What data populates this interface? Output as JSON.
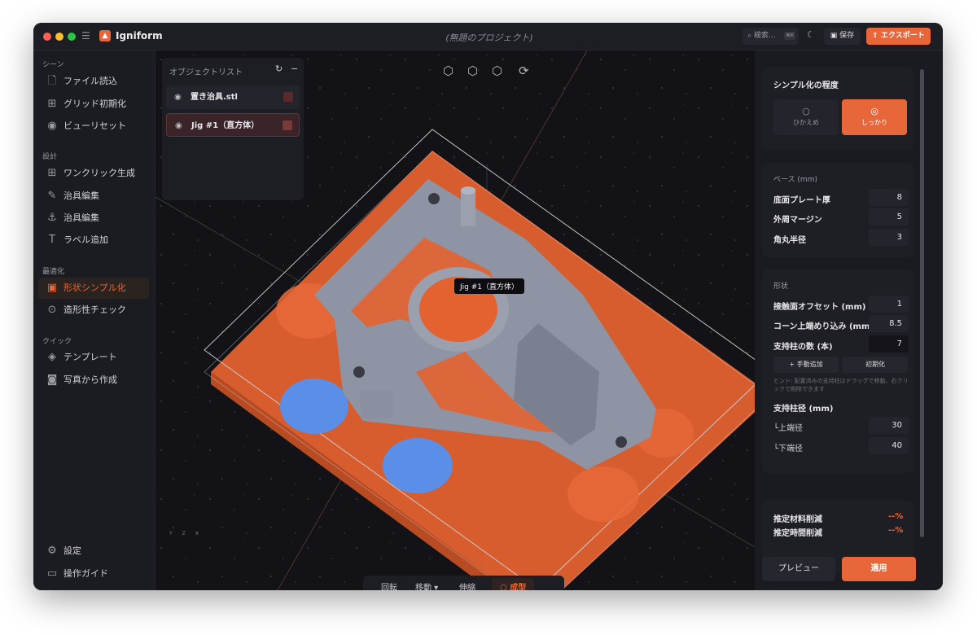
{
  "titlebar": {
    "app_name": "Igniform",
    "project_title": "(無題のプロジェクト)",
    "search_label": "検索…",
    "search_shortcut": "⌘K",
    "save_label": "保存",
    "export_label": "エクスポート"
  },
  "sidebar": {
    "sections": [
      {
        "title": "シーン",
        "items": [
          {
            "label": "ファイル読込",
            "icon": "file-icon"
          },
          {
            "label": "グリッド初期化",
            "icon": "grid-icon"
          },
          {
            "label": "ビューリセット",
            "icon": "eye-icon"
          }
        ]
      },
      {
        "title": "設計",
        "items": [
          {
            "label": "ワンクリック生成",
            "icon": "plus-square-icon"
          },
          {
            "label": "治具編集",
            "icon": "edit-icon"
          },
          {
            "label": "治具編集",
            "icon": "anchor-icon"
          },
          {
            "label": "ラベル追加",
            "icon": "text-icon"
          }
        ]
      },
      {
        "title": "最適化",
        "items": [
          {
            "label": "形状シンプル化",
            "icon": "simplify-icon",
            "active": true
          },
          {
            "label": "造形性チェック",
            "icon": "check-circle-icon"
          }
        ]
      },
      {
        "title": "クイック",
        "items": [
          {
            "label": "テンプレート",
            "icon": "layers-icon"
          },
          {
            "label": "写真から作成",
            "icon": "camera-icon"
          }
        ]
      }
    ],
    "footer": [
      {
        "label": "設定",
        "icon": "gear-icon"
      },
      {
        "label": "操作ガイド",
        "icon": "book-icon"
      }
    ]
  },
  "object_list": {
    "title": "オブジェクトリスト",
    "items": [
      {
        "label": "置き治具.stl",
        "selected": false
      },
      {
        "label": "Jig #1（直方体）",
        "selected": true
      }
    ]
  },
  "viewport": {
    "tooltip": "Jig #1（直方体）",
    "axes": [
      "Y",
      "Z",
      "X"
    ],
    "toolbar": [
      {
        "label": "回転"
      },
      {
        "label": "移動 ▾"
      },
      {
        "label": "伸縮"
      },
      {
        "label": "成型",
        "active": true
      }
    ],
    "colors": {
      "plate": "#e8673a",
      "part": "#8e94a3",
      "support": "#5b8ee6",
      "background": "#121217"
    }
  },
  "right_panel": {
    "simplify": {
      "title": "シンプル化の程度",
      "options": [
        {
          "label": "ひかえめ",
          "selected": false
        },
        {
          "label": "しっかり",
          "selected": true
        }
      ]
    },
    "base": {
      "title": "ベース (mm)",
      "rows": [
        {
          "label": "底面プレート厚",
          "value": "8"
        },
        {
          "label": "外周マージン",
          "value": "5"
        },
        {
          "label": "角丸半径",
          "value": "3"
        }
      ]
    },
    "shape": {
      "title": "形状",
      "rows": [
        {
          "label": "接触面オフセット (mm)",
          "value": "1"
        },
        {
          "label": "コーン上端めり込み (mm)",
          "value": "8.5"
        },
        {
          "label": "支持柱の数 (本)",
          "value": "7"
        }
      ],
      "add_manual": "+ 手動追加",
      "reset": "初期化",
      "hint": "ヒント: 配置済みの支持柱はドラッグで移動、右クリックで削除できます",
      "diameter_title": "支持柱径 (mm)",
      "diameter_rows": [
        {
          "label": "上端径",
          "value": "30"
        },
        {
          "label": "下端径",
          "value": "40"
        }
      ]
    },
    "estimate": {
      "rows": [
        {
          "label": "推定材料削減",
          "value": "--%"
        },
        {
          "label": "推定時間削減",
          "value": "--%"
        }
      ]
    },
    "preview_label": "プレビュー",
    "apply_label": "適用"
  }
}
